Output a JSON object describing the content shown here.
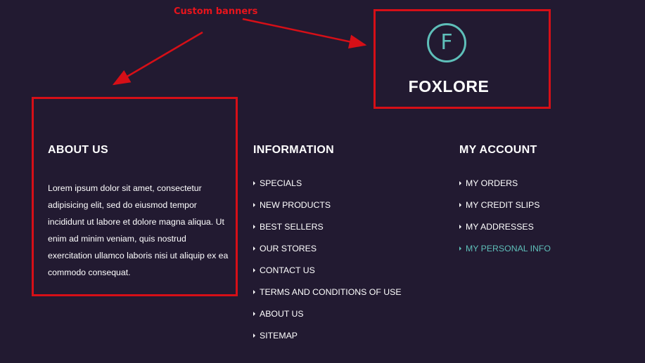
{
  "annotation": {
    "label": "Custom banners",
    "color": "#d60f17"
  },
  "logo": {
    "letter": "F",
    "name": "FOXLORE",
    "accent": "#5ebfb9"
  },
  "about": {
    "title": "ABOUT US",
    "text": "Lorem ipsum dolor sit amet, consectetur adipisicing elit, sed do eiusmod tempor incididunt ut labore et dolore magna aliqua. Ut enim ad minim veniam, quis nostrud exercitation ullamco laboris nisi ut aliquip ex ea commodo consequat."
  },
  "information": {
    "title": "INFORMATION",
    "links": [
      "SPECIALS",
      "NEW PRODUCTS",
      "BEST SELLERS",
      "OUR STORES",
      "CONTACT US",
      "TERMS AND CONDITIONS OF USE",
      "ABOUT US",
      "SITEMAP"
    ]
  },
  "account": {
    "title": "MY ACCOUNT",
    "links": [
      "MY ORDERS",
      "MY CREDIT SLIPS",
      "MY ADDRESSES",
      "MY PERSONAL INFO"
    ],
    "active_index": 3
  },
  "colors": {
    "background": "#221a31",
    "text": "#ffffff",
    "accent": "#5ebfb9"
  }
}
